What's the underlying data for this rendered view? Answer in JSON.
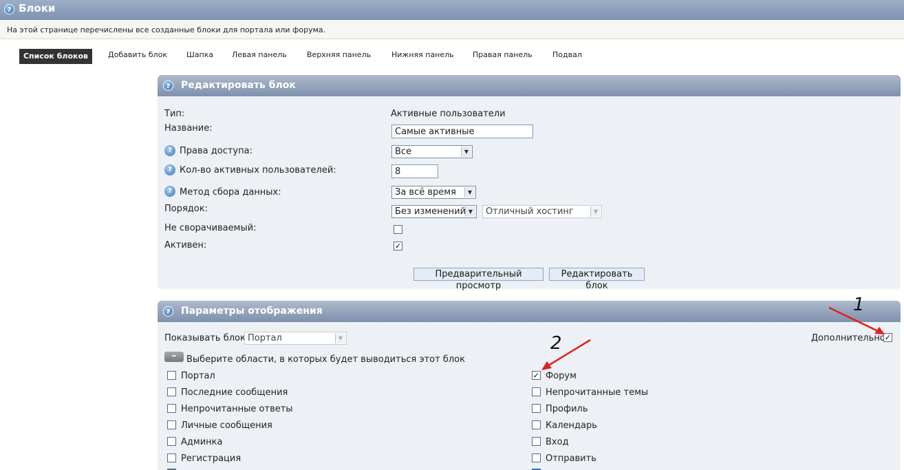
{
  "header": {
    "title": "Блоки",
    "icon": "help-icon"
  },
  "description": "На этой странице перечислены все созданные блоки для портала или форума.",
  "tabs": [
    {
      "label": "Список блоков",
      "active": true
    },
    {
      "label": "Добавить блок"
    },
    {
      "label": "Шапка"
    },
    {
      "label": "Левая панель"
    },
    {
      "label": "Верхняя панель"
    },
    {
      "label": "Нижняя панель"
    },
    {
      "label": "Правая панель"
    },
    {
      "label": "Подвал"
    }
  ],
  "edit_block": {
    "title": "Редактировать блок",
    "type_label": "Тип:",
    "type_value": "Активные пользователи",
    "name_label": "Название:",
    "name_value": "Самые активные",
    "access_label": "Права доступа:",
    "access_value": "Все",
    "count_label": "Кол-во активных пользователей:",
    "count_value": "8",
    "method_label": "Метод сбора данных:",
    "method_value": "За всё время",
    "order_label": "Порядок:",
    "order_value": "Без изменений",
    "order_ref_value": "Отличный хостинг",
    "nocollapse_label": "Не сворачиваемый:",
    "nocollapse_checked": false,
    "active_label": "Активен:",
    "active_checked": true,
    "preview_button": "Предварительный просмотр",
    "save_button": "Редактировать блок"
  },
  "display": {
    "title": "Параметры отображения",
    "show_label": "Показывать блок",
    "show_value": "Портал",
    "advanced_label": "Дополнительно",
    "advanced_checked": true,
    "toggle_symbol": "–",
    "areas_label": "Выберите области, в которых будет выводиться этот блок",
    "areas_left": [
      {
        "label": "Портал",
        "checked": false
      },
      {
        "label": "Последние сообщения",
        "checked": false
      },
      {
        "label": "Непрочитанные ответы",
        "checked": false
      },
      {
        "label": "Личные сообщения",
        "checked": false
      },
      {
        "label": "Админка",
        "checked": false
      },
      {
        "label": "Регистрация",
        "checked": false
      }
    ],
    "areas_right": [
      {
        "label": "Форум",
        "checked": true
      },
      {
        "label": "Непрочитанные темы",
        "checked": false
      },
      {
        "label": "Профиль",
        "checked": false
      },
      {
        "label": "Календарь",
        "checked": false
      },
      {
        "label": "Вход",
        "checked": false
      },
      {
        "label": "Отправить",
        "checked": false
      }
    ]
  },
  "annotations": {
    "mark_1": "1",
    "mark_2": "2",
    "arrow_color": "#e0201c"
  }
}
